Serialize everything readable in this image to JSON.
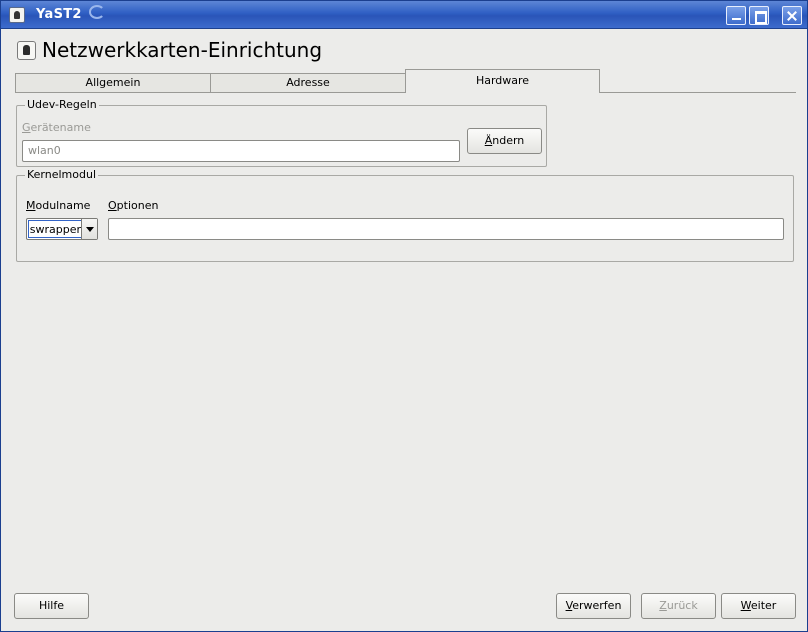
{
  "window": {
    "title": "YaST2",
    "app_icon": "yast-icon",
    "controls": [
      "minimize-icon",
      "maximize-icon",
      "close-icon"
    ]
  },
  "heading": {
    "icon": "network-card-icon",
    "title": "Netzwerkkarten-Einrichtung"
  },
  "tabs": {
    "items": [
      {
        "label": "Allgemein"
      },
      {
        "label": "Adresse"
      },
      {
        "label": "Hardware"
      }
    ],
    "active": "Hardware"
  },
  "udev": {
    "legend": "Udev-Regeln",
    "device_name": {
      "label_first": "G",
      "label_rest": "erätename",
      "value": "wlan0"
    },
    "change_button": {
      "first": "Ä",
      "rest": "ndern"
    }
  },
  "kernel": {
    "legend": "Kernelmodul",
    "module": {
      "label_first": "M",
      "label_rest": "odulname",
      "value": "ndiswrapper"
    },
    "options": {
      "label_first": "O",
      "label_rest": "ptionen",
      "value": ""
    }
  },
  "footer": {
    "help": "Hilfe",
    "discard": {
      "first": "V",
      "rest": "erwerfen"
    },
    "back": {
      "first": "Z",
      "rest": "urück"
    },
    "next": {
      "first": "W",
      "rest": "eiter"
    }
  },
  "colors": {
    "titlebar": "#2f5fc4",
    "window_bg": "#ececea",
    "disabled_text": "#9a9a96",
    "focus_border": "#3264c8"
  }
}
